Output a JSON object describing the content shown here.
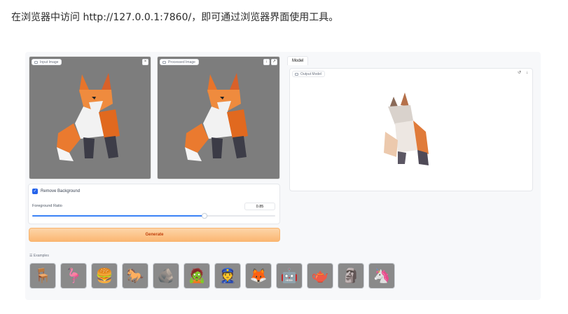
{
  "intro_text": "在浏览器中访问 http://127.0.0.1:7860/，即可通过浏览器界面使用工具。",
  "input_panel": {
    "label": "Input Image",
    "close_icon": "×"
  },
  "processed_panel": {
    "label": "Processed Image"
  },
  "model_tab": {
    "label": "Model"
  },
  "output_model": {
    "label": "Output Model"
  },
  "remove_background": {
    "label": "Remove Background",
    "checked": true
  },
  "foreground_ratio": {
    "label": "Foreground Ratio",
    "value": "0.85",
    "fraction": 0.71
  },
  "generate_button": {
    "label": "Generate"
  },
  "examples": {
    "label": "Examples",
    "items": [
      {
        "name": "chair",
        "glyph": "🪑"
      },
      {
        "name": "flamingo",
        "glyph": "🦩"
      },
      {
        "name": "burger",
        "glyph": "🍔"
      },
      {
        "name": "horse",
        "glyph": "🐎"
      },
      {
        "name": "rocks",
        "glyph": "🪨"
      },
      {
        "name": "mummy",
        "glyph": "🧟"
      },
      {
        "name": "police",
        "glyph": "👮"
      },
      {
        "name": "fox",
        "glyph": "🦊"
      },
      {
        "name": "robot",
        "glyph": "🤖"
      },
      {
        "name": "teapot",
        "glyph": "🫖"
      },
      {
        "name": "figure",
        "glyph": "🗿"
      },
      {
        "name": "unicorn",
        "glyph": "🦄"
      }
    ]
  },
  "colors": {
    "accent": "#2563eb",
    "generate": "#fbb773",
    "image_bg": "#7d7d7d"
  }
}
